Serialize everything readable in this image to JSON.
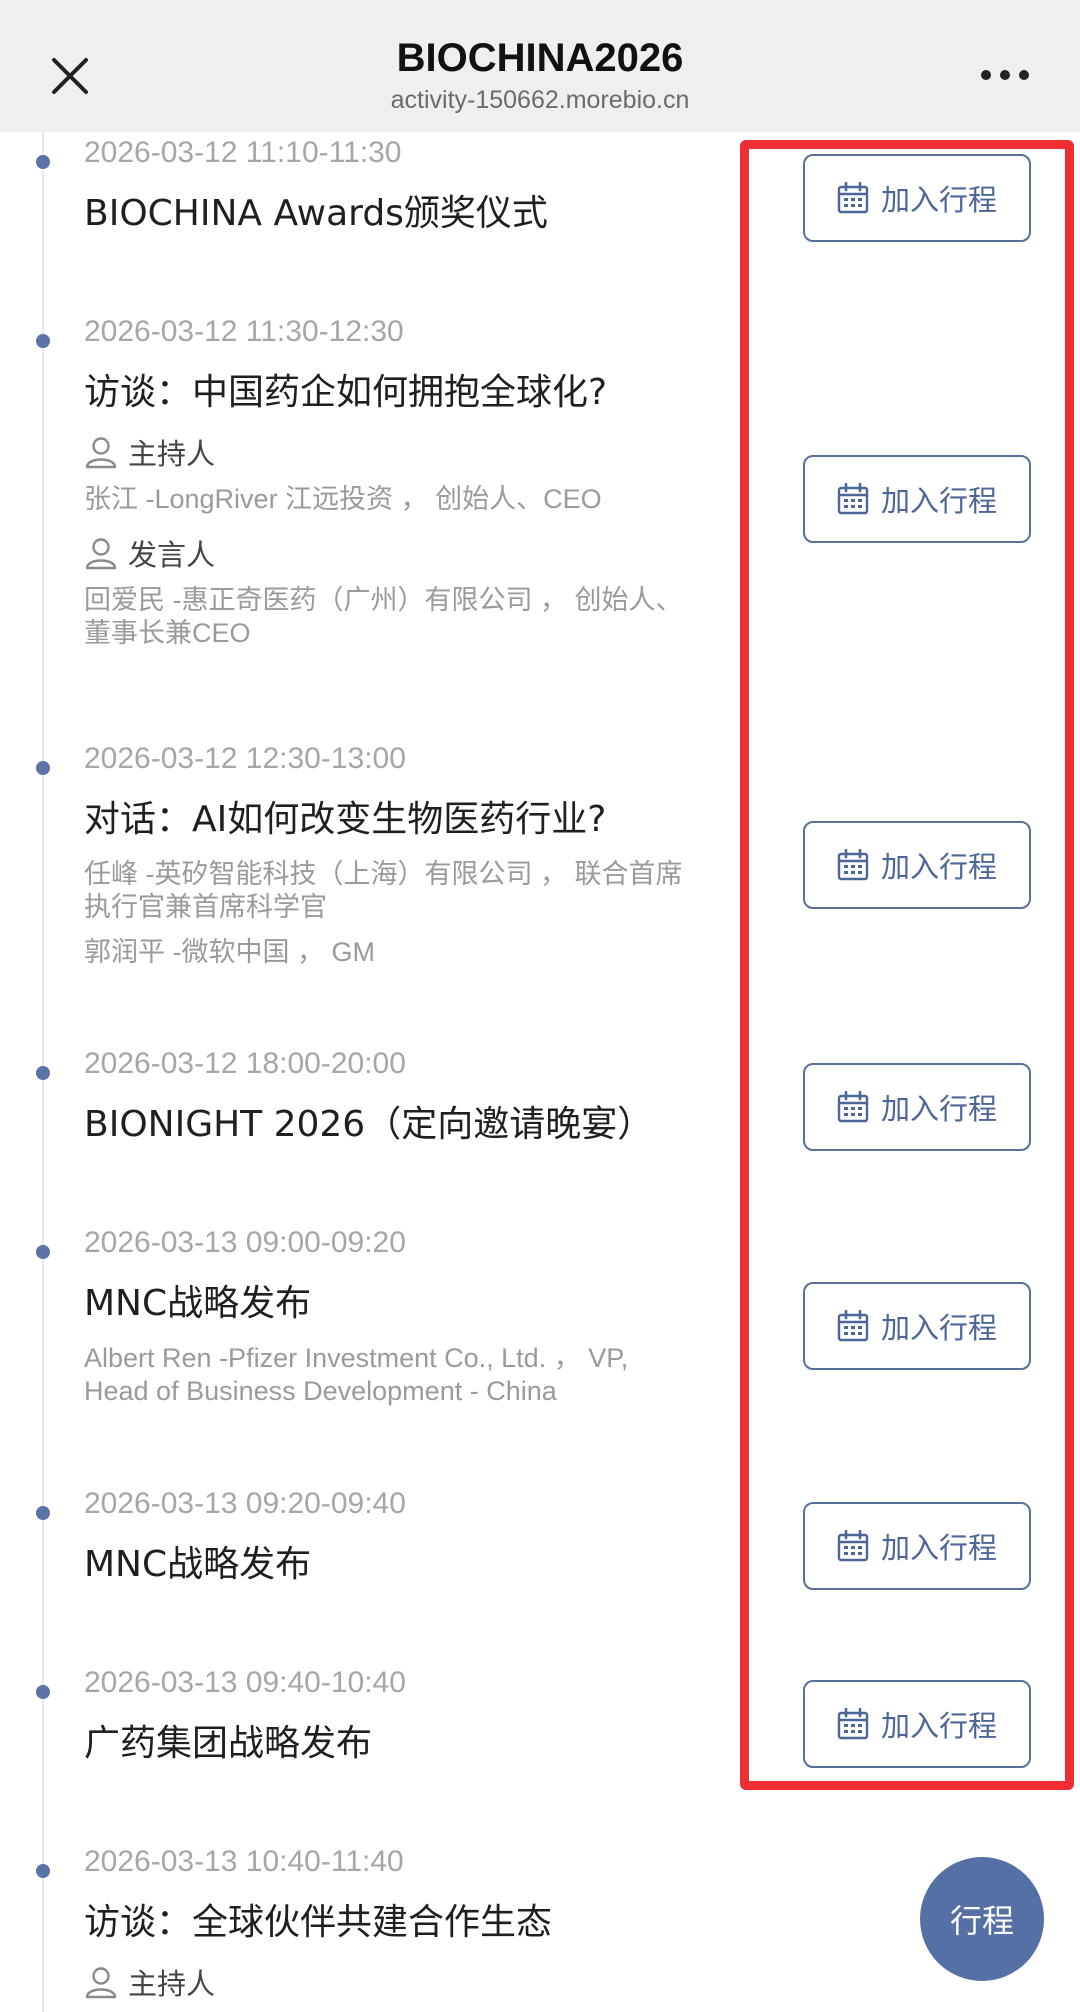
{
  "header": {
    "title": "BIOCHINA2026",
    "url": "activity-150662.morebio.cn"
  },
  "add_label": "加入行程",
  "fab_label": "行程",
  "colors": {
    "accent": "#5570a5",
    "highlight": "#ee2e33",
    "timeline_dot": "#5a74a8"
  },
  "events": [
    {
      "time": "2026-03-12   11:10-11:30",
      "title": "BIOCHINA Awards颁奖仪式"
    },
    {
      "time": "2026-03-12   11:30-12:30",
      "title": "访谈：中国药企如何拥抱全球化?",
      "host_label": "主持人",
      "host": "张江 -LongRiver 江远投资 ， 创始人、CEO",
      "speaker_label": "发言人",
      "speaker_line1": "回爱民 -惠正奇医药（广州）有限公司 ， 创始人、",
      "speaker_line2": "董事长兼CEO"
    },
    {
      "time": "2026-03-12   12:30-13:00",
      "title": "对话：AI如何改变生物医药行业?",
      "speaker1_line1": "任峰 -英矽智能科技（上海）有限公司 ， 联合首席",
      "speaker1_line2": "执行官兼首席科学官",
      "speaker2": "郭润平 -微软中国 ， GM"
    },
    {
      "time": "2026-03-12   18:00-20:00",
      "title": "BIONIGHT 2026（定向邀请晚宴）"
    },
    {
      "time": "2026-03-13   09:00-09:20",
      "title": "MNC战略发布",
      "speaker_line1": "Albert Ren -Pfizer Investment Co., Ltd. ， VP,",
      "speaker_line2": "Head of Business Development - China"
    },
    {
      "time": "2026-03-13   09:20-09:40",
      "title": "MNC战略发布"
    },
    {
      "time": "2026-03-13   09:40-10:40",
      "title": "广药集团战略发布"
    },
    {
      "time": "2026-03-13   10:40-11:40",
      "title": "访谈：全球伙伴共建合作生态",
      "host_label": "主持人"
    }
  ]
}
